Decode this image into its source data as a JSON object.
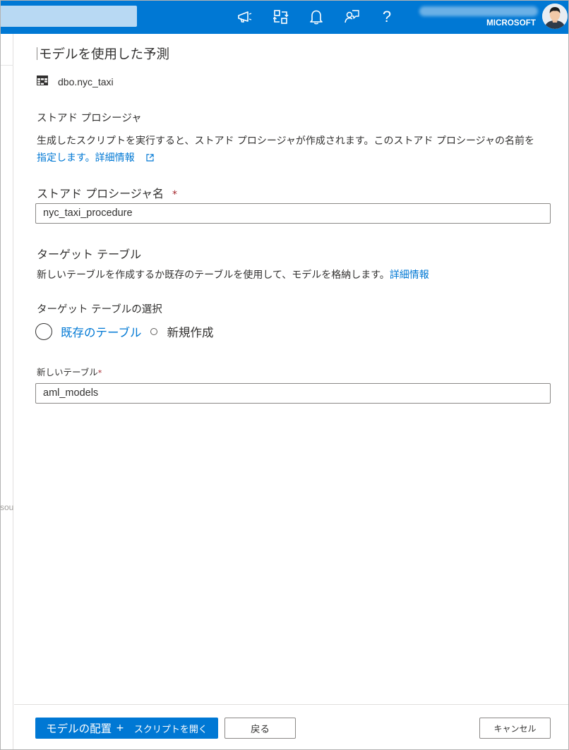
{
  "topbar": {
    "icons": [
      "megaphone-icon",
      "directory-switch-icon",
      "bell-icon",
      "feedback-icon",
      "help-icon"
    ],
    "help_glyph": "?",
    "tenant": "MICROSOFT",
    "brand_color": "#0078d4"
  },
  "left_ghost_text": "sou",
  "panel": {
    "title": "モデルを使用した予測",
    "table_name": "dbo.nyc_taxi",
    "stored_procedure": {
      "heading": "ストアド プロシージャ",
      "desc_line1": "生成したスクリプトを実行すると、ストアド プロシージャが作成されます。このストアド プロシージャの名前を",
      "desc_line2": "指定します。詳細情報",
      "name_label": "ストアド プロシージャ名",
      "required_mark": "*",
      "name_value": "nyc_taxi_procedure"
    },
    "target_table": {
      "heading": "ターゲット テーブル",
      "desc": "新しいテーブルを作成するか既存のテーブルを使用して、モデルを格納します。",
      "desc_link": "詳細情報",
      "select_label": "ターゲット テーブルの選択",
      "option_existing": "既存のテーブル",
      "option_new": "新規作成",
      "new_table_label": "新しいテーブル",
      "required_mark": "*",
      "new_table_value": "aml_models"
    }
  },
  "footer": {
    "primary_part1": "モデルの配置",
    "primary_part2": "+",
    "primary_part3": "スクリプトを開く",
    "back": "戻る",
    "cancel": "キャンセル"
  }
}
